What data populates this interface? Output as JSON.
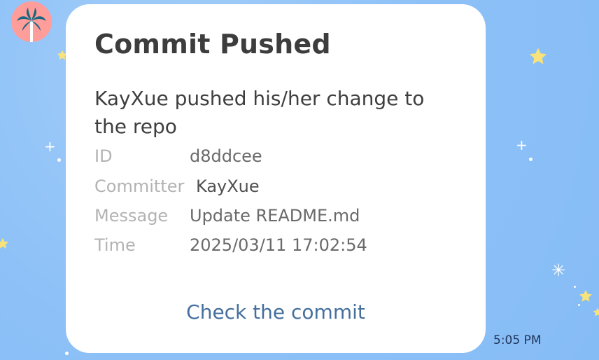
{
  "avatar": {
    "icon": "palm-tree-icon",
    "background": "#ff9d9b"
  },
  "card": {
    "title": "Commit Pushed",
    "description": "KayXue pushed his/her change to the repo",
    "fields": [
      {
        "label": "ID",
        "value": "d8ddcee"
      },
      {
        "label": "Committer",
        "value": "KayXue"
      },
      {
        "label": "Message",
        "value": "Update README.md"
      },
      {
        "label": "Time",
        "value": "2025/03/11 17:02:54"
      }
    ],
    "link": "Check the commit"
  },
  "message_time": "5:05 PM",
  "colors": {
    "background": "#8cc0f7",
    "card": "#ffffff",
    "link": "#456f9d",
    "title": "#3d3d3d"
  }
}
